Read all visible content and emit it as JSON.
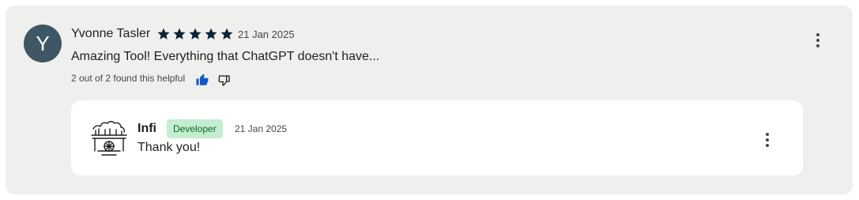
{
  "review": {
    "avatar_initial": "Y",
    "author": "Yvonne Tasler",
    "rating": 5,
    "rating_max": 5,
    "date": "21 Jan 2025",
    "text": "Amazing Tool! Everything that ChatGPT doesn't have...",
    "helpful_text": "2 out of 2 found this helpful",
    "thumbs_up_selected": true,
    "colors": {
      "star": "#0b2537",
      "avatar_bg": "#3f5765",
      "thumb_active": "#0b57d0",
      "card_bg": "#eff0ed"
    },
    "icons": {
      "more": "more-vert-icon",
      "like": "thumb-up-icon",
      "dislike": "thumb-down-icon",
      "star": "star-icon"
    }
  },
  "reply": {
    "developer_name": "Infi",
    "badge": "Developer",
    "date": "21 Jan 2025",
    "text": "Thank you!",
    "colors": {
      "badge_bg": "#c4eed0",
      "badge_text": "#0d652d"
    },
    "icons": {
      "logo": "developer-logo-icon",
      "more": "more-vert-icon"
    }
  }
}
